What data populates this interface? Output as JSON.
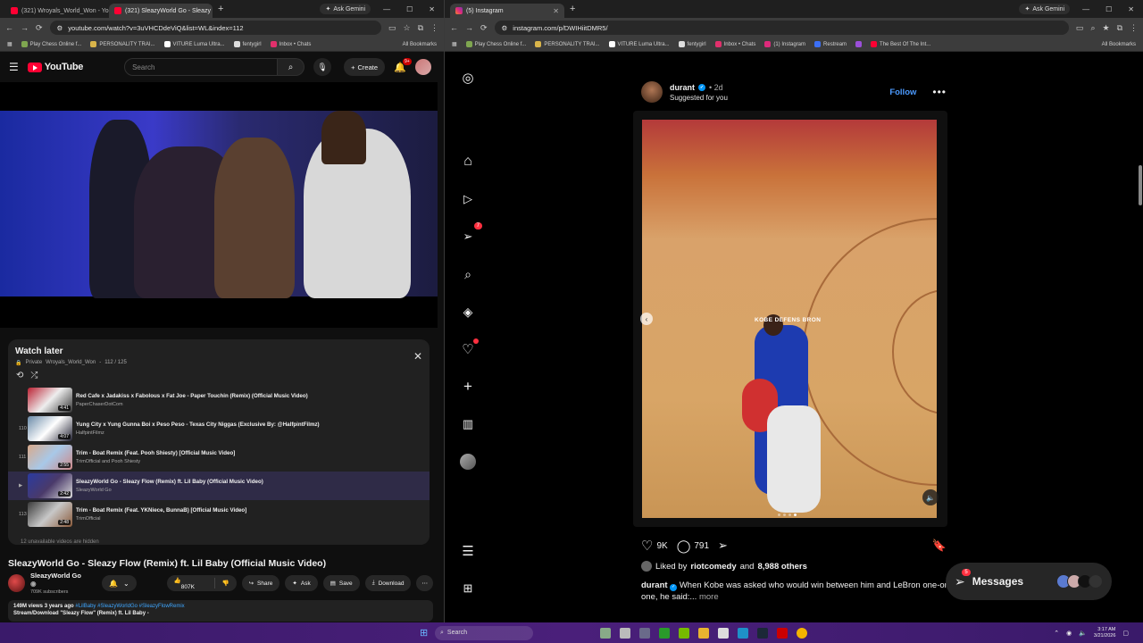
{
  "left_browser": {
    "tabs": [
      {
        "label": "(321) Wroyals_World_Won - Yo",
        "active": false
      },
      {
        "label": "(321) SleazyWorld Go - Sleazy",
        "active": true
      }
    ],
    "ask_gemini": "Ask Gemini",
    "url": "youtube.com/watch?v=3uVHCDdeViQ&list=WL&index=112",
    "bookmarks": [
      "Play Chess Online f...",
      "PERSONALITY TRAI...",
      "VITURE Luma Ultra...",
      "fentygirl",
      "Inbox • Chats"
    ],
    "all_bookmarks": "All Bookmarks"
  },
  "youtube": {
    "logo": "YouTube",
    "search_placeholder": "Search",
    "create_label": "Create",
    "notification_count": "9+",
    "watch_later": {
      "title": "Watch later",
      "privacy": "Private",
      "owner": "Wroyals_World_Won",
      "position": "112 / 125",
      "items": [
        {
          "num": "",
          "title": "Red Cafe x Jadakiss x Fabolous x Fat Joe - Paper Touchin (Remix) (Official Music Video)",
          "channel": "PaperChaserDotCom",
          "duration": "4:41"
        },
        {
          "num": "110",
          "title": "Yung City x Yung Gunna Boi x Peso Peso - Texas City Niggas (Exclusive By: @HalfpintFilmz)",
          "channel": "HalfpintFilmz",
          "duration": "4:07"
        },
        {
          "num": "111",
          "title": "Trim - Boat Remix (Feat. Pooh Shiesty) [Official Music Video]",
          "channel": "TrimOfficial and Pooh Shiesty",
          "duration": "2:55"
        },
        {
          "num": "▶",
          "title": "SleazyWorld Go - Sleazy Flow (Remix) ft. Lil Baby (Official Music Video)",
          "channel": "SleazyWorld Go",
          "duration": "2:42"
        },
        {
          "num": "113",
          "title": "Trim - Boat Remix (Feat. YKNiece, BunnaB) [Official Music Video]",
          "channel": "TrimOfficial",
          "duration": "2:48"
        }
      ],
      "hidden_note": "12 unavailable videos are hidden"
    },
    "video_title": "SleazyWorld Go - Sleazy Flow (Remix) ft. Lil Baby (Official Music Video)",
    "channel_name": "SleazyWorld Go",
    "subscribers": "709K subscribers",
    "likes": "807K",
    "share": "Share",
    "ask": "Ask",
    "save": "Save",
    "download": "Download",
    "desc_stats": "149M views  3 years ago",
    "desc_tags": "#LilBaby #SleazyWorldGo #SleazyFlowRemix",
    "desc_line2": "Stream/Download \"Sleazy Flow\" (Remix) ft. Lil Baby -"
  },
  "right_browser": {
    "tab": "(5) Instagram",
    "ask_gemini": "Ask Gemini",
    "url": "instagram.com/p/DWIHiitDMR5/",
    "bookmarks": [
      "Play Chess Online f...",
      "PERSONALITY TRAI...",
      "VITURE Luma Ultra...",
      "fentygirl",
      "Inbox • Chats",
      "(1) Instagram",
      "Restream",
      "The Best Of The Int..."
    ],
    "all_bookmarks": "All Bookmarks"
  },
  "instagram": {
    "notification_count": "7",
    "post": {
      "username": "durant",
      "time": "2d",
      "suggested": "Suggested for you",
      "follow": "Follow",
      "overlay_text": "KOBE DEFENS BRON",
      "likes_count": "9K",
      "comments_count": "791",
      "liked_by_user": "riotcomedy",
      "liked_by_others": "8,988 others",
      "caption_user": "durant",
      "caption": "When Kobe was asked who would win between him and LeBron one-on-one, he said:...",
      "more": "more"
    },
    "messages_label": "Messages",
    "messages_count": "5"
  },
  "taskbar": {
    "search": "Search",
    "time": "3:17 AM",
    "date": "3/21/2026"
  }
}
